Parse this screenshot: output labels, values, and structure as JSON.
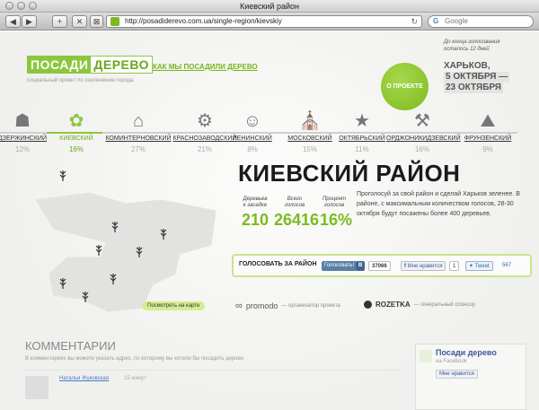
{
  "window": {
    "title": "Киевский район"
  },
  "toolbar": {
    "url": "http://posadiderevo.com.ua/single-region/kievskiy",
    "search_placeholder": "Google"
  },
  "header": {
    "logo_part1": "ПОСАДИ",
    "logo_part2": "ДЕРЕВО",
    "tagline": "социальный проект по озеленению города",
    "how_link": "КАК МЫ ПОСАДИЛИ ДЕРЕВО",
    "about_button": "О ПРОЕКТЕ",
    "countdown_line1": "До конца голосования",
    "countdown_line2": "осталось 12 дней",
    "city": "ХАРЬКОВ,",
    "date_from": "5 ОКТЯБРЯ —",
    "date_to": "23 ОКТЯБРЯ"
  },
  "districts": [
    {
      "name": "ДЗЕРЖИНСКИЙ",
      "percent": "12%"
    },
    {
      "name": "КИЕВСКИЙ",
      "percent": "16%"
    },
    {
      "name": "КОМИНТЕРНОВСКИЙ",
      "percent": "27%"
    },
    {
      "name": "КРАСНОЗАВОДСКИЙ",
      "percent": "21%"
    },
    {
      "name": "ЛЕНИНСКИЙ",
      "percent": "8%"
    },
    {
      "name": "МОСКОВСКИЙ",
      "percent": "15%"
    },
    {
      "name": "ОКТЯБРЬСКИЙ",
      "percent": "11%"
    },
    {
      "name": "ОРДЖОНИКИДЗЕВСКИЙ",
      "percent": "16%"
    },
    {
      "name": "ФРУНЗЕНСКИЙ",
      "percent": "9%"
    }
  ],
  "region": {
    "title": "КИЕВСКИЙ РАЙОН",
    "stats": [
      {
        "label1": "Деревьев",
        "label2": "к засадке",
        "value": "210"
      },
      {
        "label1": "Всего",
        "label2": "голосов",
        "value": "26416"
      },
      {
        "label1": "Процент",
        "label2": "голосов",
        "value": "16%"
      }
    ],
    "description": "Проголосуй за свой район и сделай Харьков зеленее. В районе, с максимальным количеством голосов, 28-30 октября будут посажены более 400 деревьев."
  },
  "vote": {
    "label": "ГОЛОСОВАТЬ ЗА РАЙОН",
    "vk_button": "Голосовать!",
    "vk_letter": "В",
    "vk_count": "37066",
    "fb_button": "Мне нравится",
    "fb_count": "1",
    "tweet_button": "Tweet",
    "tweet_count": "567"
  },
  "map": {
    "button": "Посмотреть на карте"
  },
  "sponsors": {
    "promodo": "promodo",
    "promodo_role": "— организатор проекта",
    "rozetka": "ROZETKA",
    "rozetka_role": "— генеральный спонсор"
  },
  "comments": {
    "title": "КОММЕНТАРИИ",
    "hint": "В комментариях вы можете указать адрес, по которому вы хотели бы посадить дерево",
    "first_author": "Наталья Жуковская",
    "first_time": "15 минут"
  },
  "facebook_box": {
    "title": "Посади дерево",
    "subtitle": "на Facebook",
    "like_text": "Мне нравится"
  }
}
